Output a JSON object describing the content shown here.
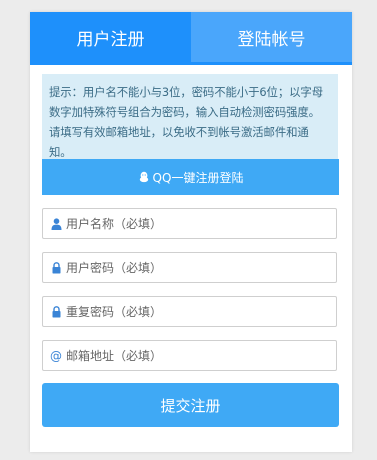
{
  "tabs": [
    {
      "label": "用户注册",
      "active": true
    },
    {
      "label": "登陆帐号",
      "active": false
    }
  ],
  "notice": {
    "text": "提示：用户名不能小与3位，密码不能小于6位；以字母数字加特殊符号组合为密码，输入自动检测密码强度。请填写有效邮箱地址，以免收不到帐号激活邮件和通知。"
  },
  "qq_login": {
    "label": "QQ一键注册登陆",
    "icon": "qq-penguin-icon"
  },
  "form": {
    "username": {
      "placeholder": "用户名称（必填）",
      "icon": "user-icon"
    },
    "password": {
      "placeholder": "用户密码（必填）",
      "icon": "lock-icon"
    },
    "repeat_password": {
      "placeholder": "重复密码（必填）",
      "icon": "lock-icon"
    },
    "email": {
      "placeholder": "邮箱地址（必填）",
      "icon": "at-icon"
    }
  },
  "submit": {
    "label": "提交注册"
  },
  "colors": {
    "tab_active": "#1e90fb",
    "tab_inactive": "#4aa6fb",
    "button": "#3fa9f5",
    "notice_bg": "#d9edf7",
    "notice_text": "#3b6c86",
    "icon": "#3a84d6"
  }
}
